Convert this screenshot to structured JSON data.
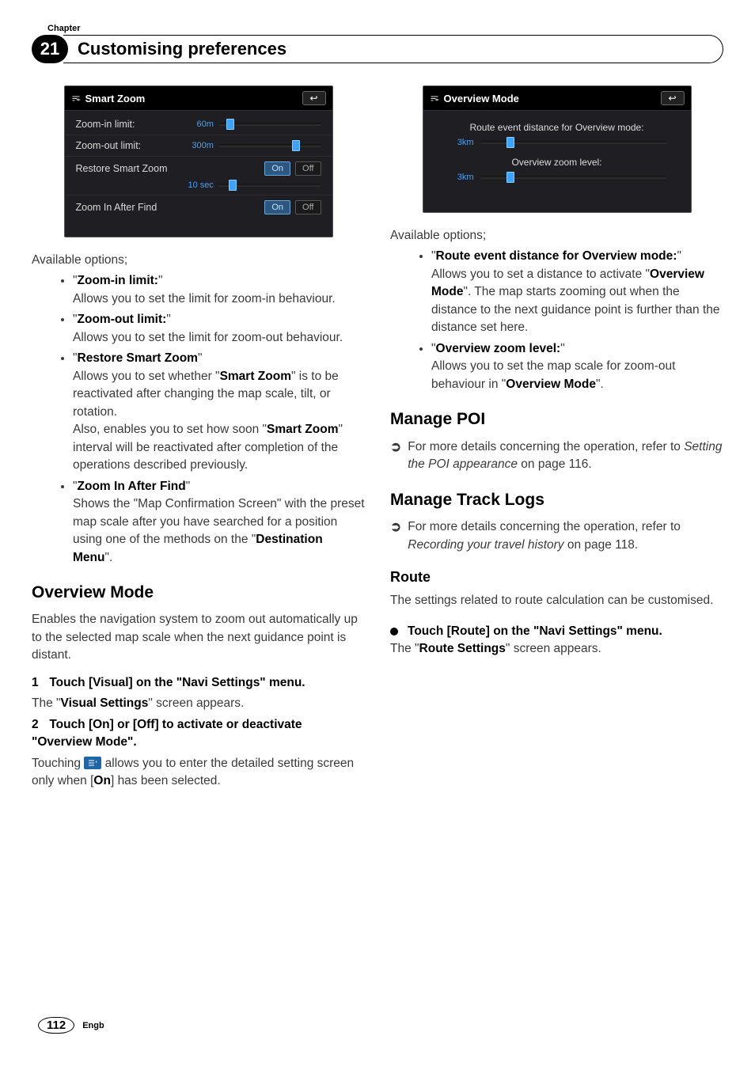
{
  "header": {
    "chapter_label": "Chapter",
    "chapter_number": "21",
    "title": "Customising preferences"
  },
  "smart_zoom_shot": {
    "title": "Smart Zoom",
    "rows": {
      "zoom_in": {
        "label": "Zoom-in limit:",
        "value": "60m",
        "thumb_pct": 8
      },
      "zoom_out": {
        "label": "Zoom-out limit:",
        "value": "300m",
        "thumb_pct": 72
      },
      "restore": {
        "label": "Restore Smart Zoom",
        "on": "On",
        "off": "Off"
      },
      "interval": {
        "value": "10 sec",
        "thumb_pct": 10
      },
      "zoom_after_find": {
        "label": "Zoom In After Find",
        "on": "On",
        "off": "Off"
      }
    }
  },
  "left_avail_label": "Available options;",
  "left_options": {
    "zoom_in": {
      "head": "Zoom-in limit:",
      "desc": "Allows you to set the limit for zoom-in behaviour."
    },
    "zoom_out": {
      "head": "Zoom-out limit:",
      "desc": "Allows you to set the limit for zoom-out behaviour."
    },
    "restore": {
      "head": "Restore Smart Zoom",
      "desc1_pre": "Allows you to set whether \"",
      "desc1_bold": "Smart Zoom",
      "desc1_post": "\" is to be reactivated after changing the map scale, tilt, or rotation.",
      "desc2_pre": "Also, enables you to set how soon \"",
      "desc2_bold": "Smart Zoom",
      "desc2_post": "\" interval will be reactivated after completion of the operations described previously."
    },
    "zoom_after_find": {
      "head": "Zoom In After Find",
      "desc_pre": "Shows the \"Map Confirmation Screen\" with the preset map scale after you have searched for a position using one of the methods on the \"",
      "desc_bold": "Destination Menu",
      "desc_post": "\"."
    }
  },
  "overview_section": {
    "title": "Overview Mode",
    "intro": "Enables the navigation system to zoom out automatically up to the selected map scale when the next guidance point is distant.",
    "step1_num": "1",
    "step1_title": "Touch [Visual] on the \"Navi Settings\" menu.",
    "step1_after_pre": "The \"",
    "step1_after_bold": "Visual Settings",
    "step1_after_post": "\" screen appears.",
    "step2_num": "2",
    "step2_title": "Touch [On] or [Off] to activate or deactivate \"Overview Mode\".",
    "step2_after_pre": "Touching ",
    "step2_after_mid": " allows you to enter the detailed setting screen only when [",
    "step2_after_bold": "On",
    "step2_after_post": "] has been selected."
  },
  "overview_shot": {
    "title": "Overview Mode",
    "caption1": "Route event distance for Overview mode:",
    "val1": "3km",
    "thumb1_pct": 14,
    "caption2": "Overview zoom level:",
    "val2": "3km",
    "thumb2_pct": 14
  },
  "right_avail_label": "Available options;",
  "right_options": {
    "route_event": {
      "head": "Route event distance for Overview mode:",
      "desc_pre": "Allows you to set a distance to activate \"",
      "desc_bold": "Overview Mode",
      "desc_post": "\". The map starts zooming out when the distance to the next guidance point is further than the distance set here."
    },
    "zoom_level": {
      "head": "Overview zoom level:",
      "desc_pre": "Allows you to set the map scale for zoom-out behaviour in \"",
      "desc_bold": "Overview Mode",
      "desc_post": "\"."
    }
  },
  "manage_poi": {
    "title": "Manage POI",
    "line_pre": "For more details concerning the operation, refer to ",
    "line_italic": "Setting the POI appearance",
    "line_post": " on page 116."
  },
  "manage_track": {
    "title": "Manage Track Logs",
    "line_pre": "For more details concerning the operation, refer to ",
    "line_italic": "Recording your travel history",
    "line_post": " on page 118."
  },
  "route_section": {
    "title": "Route",
    "intro": "The settings related to route calculation can be customised.",
    "bullet_title": "Touch [Route] on the \"Navi Settings\" menu.",
    "after_pre": "The \"",
    "after_bold": "Route Settings",
    "after_post": "\" screen appears."
  },
  "footer": {
    "page": "112",
    "lang": "Engb"
  }
}
